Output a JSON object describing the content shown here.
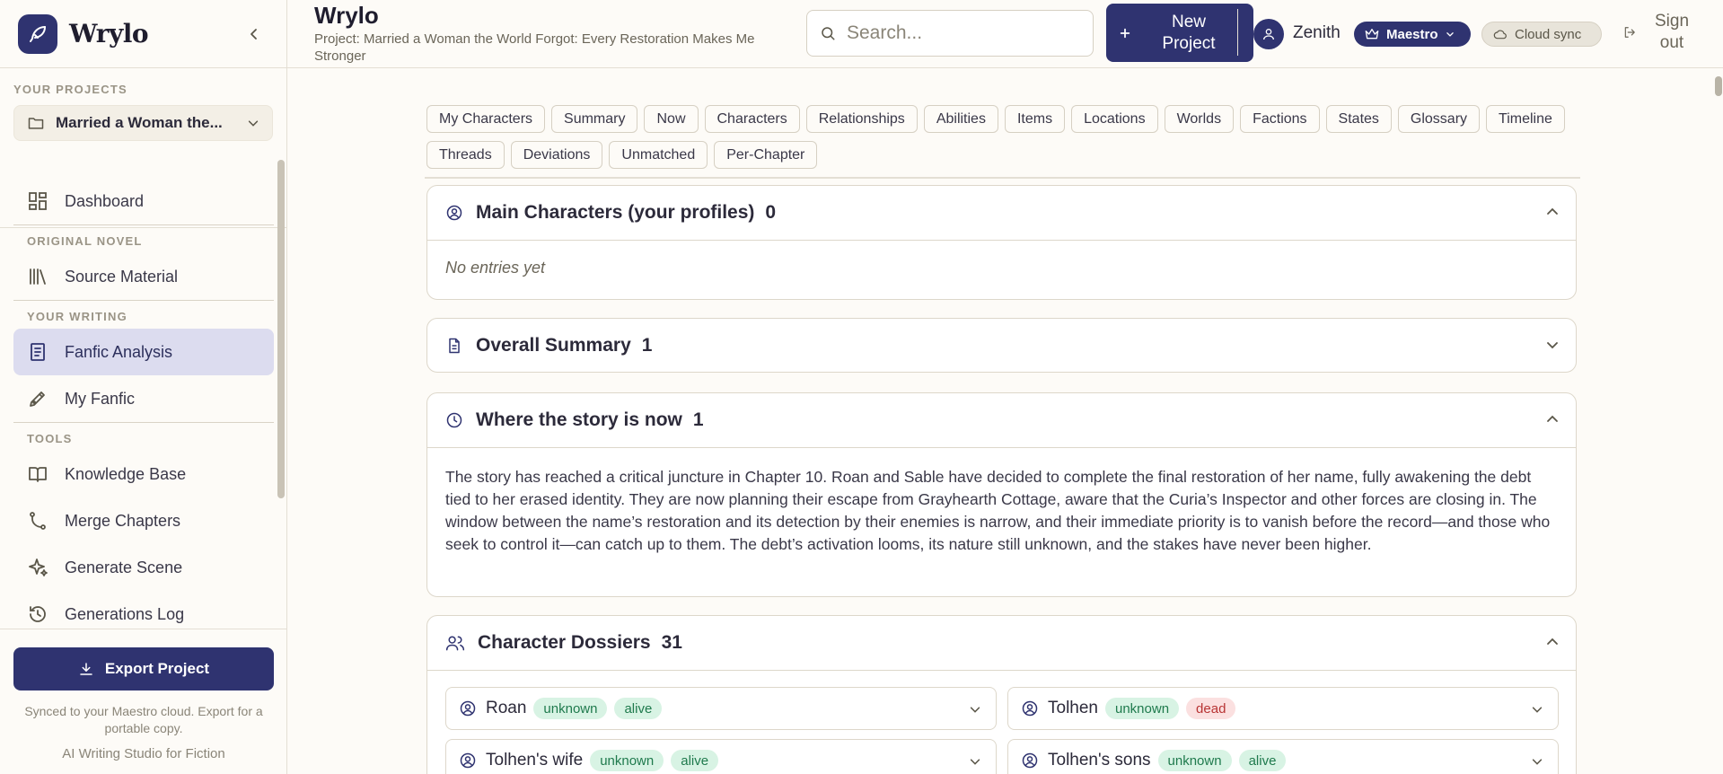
{
  "app": {
    "name": "Wrylo"
  },
  "sidebar": {
    "projects_label": "YOUR PROJECTS",
    "project_selected": "Married a Woman the...",
    "sections": {
      "original_novel": "ORIGINAL NOVEL",
      "your_writing": "YOUR WRITING",
      "tools": "TOOLS"
    },
    "items": {
      "dashboard": "Dashboard",
      "source_material": "Source Material",
      "fanfic_analysis": "Fanfic Analysis",
      "my_fanfic": "My Fanfic",
      "knowledge_base": "Knowledge Base",
      "merge_chapters": "Merge Chapters",
      "generate_scene": "Generate Scene",
      "generations_log": "Generations Log"
    },
    "export_label": "Export Project",
    "sync_note": "Synced to your Maestro cloud. Export for a portable copy.",
    "tagline": "AI Writing Studio for Fiction"
  },
  "header": {
    "title": "Wrylo",
    "subtitle": "Project: Married a Woman the World Forgot: Every Restoration Makes Me Stronger",
    "search_placeholder": "Search...",
    "new_project_label": "New Project",
    "user_name": "Zenith",
    "plan_label": "Maestro",
    "cloud_label": "Cloud sync",
    "signout_label": "Sign out"
  },
  "tabs": [
    "My Characters",
    "Summary",
    "Now",
    "Characters",
    "Relationships",
    "Abilities",
    "Items",
    "Locations",
    "Worlds",
    "Factions",
    "States",
    "Glossary",
    "Timeline",
    "Threads",
    "Deviations",
    "Unmatched",
    "Per-Chapter"
  ],
  "sections": {
    "main_characters": {
      "title": "Main Characters (your profiles)",
      "count": "0",
      "empty_text": "No entries yet"
    },
    "overall_summary": {
      "title": "Overall Summary",
      "count": "1"
    },
    "story_now": {
      "title": "Where the story is now",
      "count": "1",
      "text": "The story has reached a critical juncture in Chapter 10. Roan and Sable have decided to complete the final restoration of her name, fully awakening the debt tied to her erased identity. They are now planning their escape from Grayhearth Cottage, aware that the Curia’s Inspector and other forces are closing in. The window between the name’s restoration and its detection by their enemies is narrow, and their immediate priority is to vanish before the record—and those who seek to control it—can catch up to them. The debt’s activation looms, its nature still unknown, and the stakes have never been higher."
    },
    "dossiers": {
      "title": "Character Dossiers",
      "count": "31",
      "items": [
        {
          "name": "Roan",
          "badges": [
            {
              "text": "unknown",
              "tone": "green"
            },
            {
              "text": "alive",
              "tone": "green"
            }
          ]
        },
        {
          "name": "Tolhen",
          "badges": [
            {
              "text": "unknown",
              "tone": "green"
            },
            {
              "text": "dead",
              "tone": "red"
            }
          ]
        },
        {
          "name": "Tolhen's wife",
          "badges": [
            {
              "text": "unknown",
              "tone": "green"
            },
            {
              "text": "alive",
              "tone": "green"
            }
          ]
        },
        {
          "name": "Tolhen's sons",
          "badges": [
            {
              "text": "unknown",
              "tone": "green"
            },
            {
              "text": "alive",
              "tone": "green"
            }
          ]
        }
      ]
    }
  },
  "colors": {
    "accent": "#2f3370",
    "background": "#fdfbf7",
    "active_nav": "#dcdcef",
    "badge_green": "#d8f3e4",
    "badge_red": "#fbe0e0"
  }
}
